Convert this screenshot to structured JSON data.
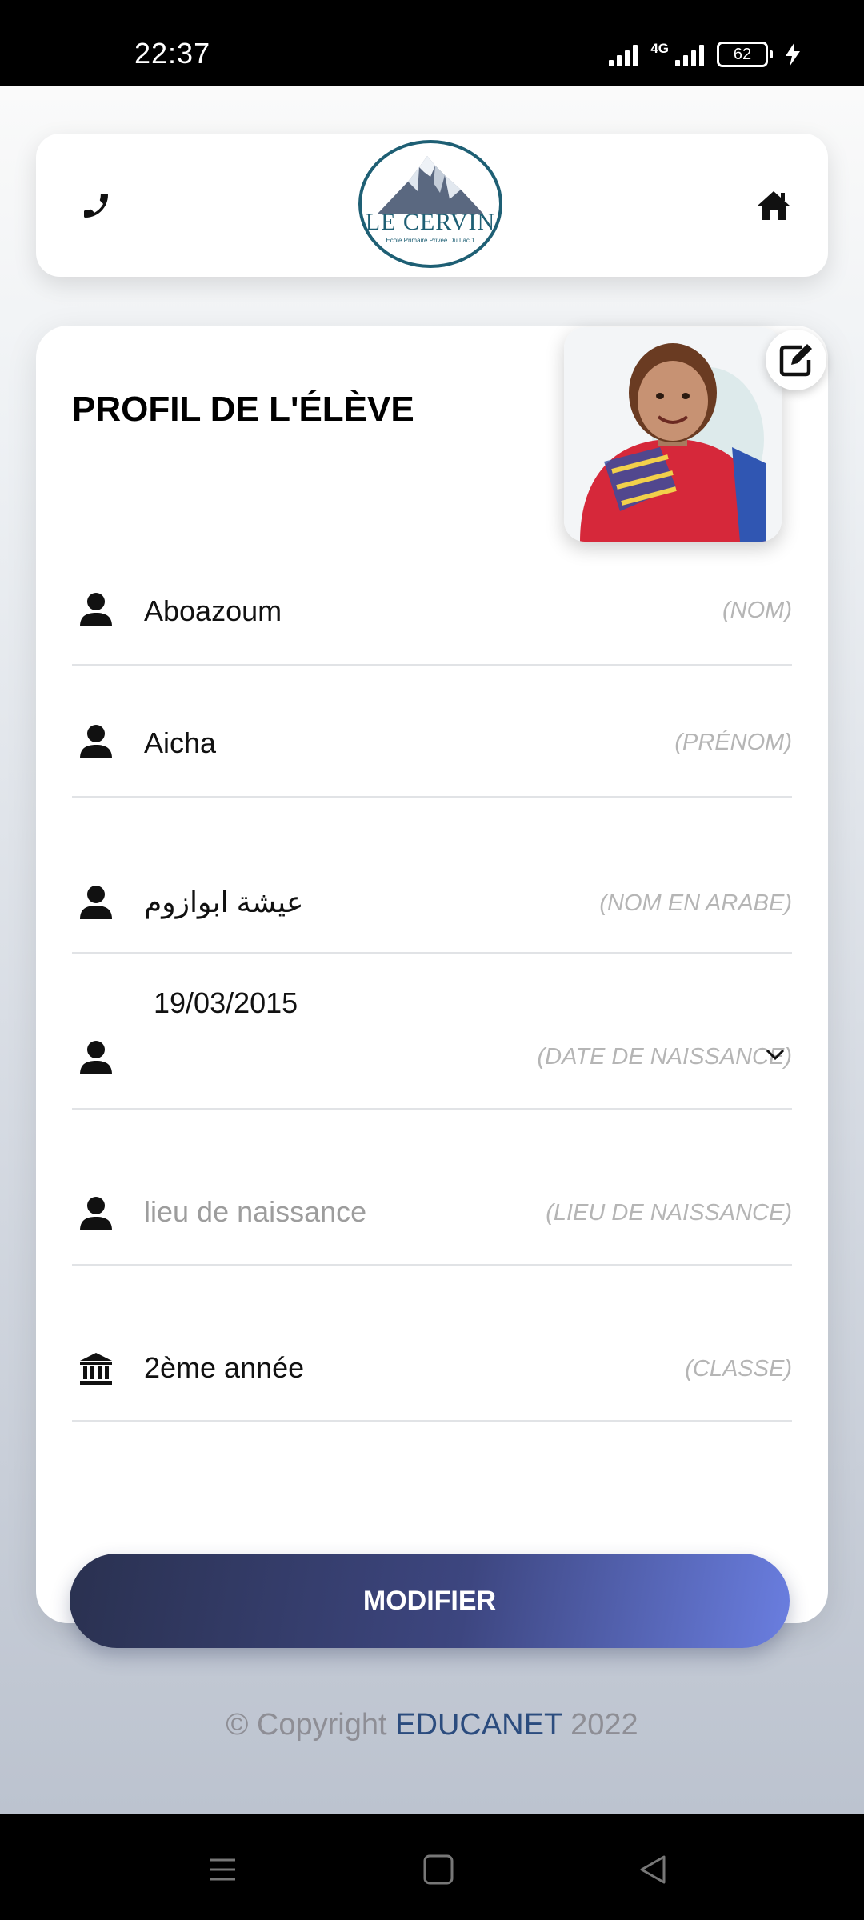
{
  "status_bar": {
    "time": "22:37",
    "network": "4G",
    "battery": "62"
  },
  "header": {
    "logo_title": "LE CERVIN",
    "logo_subtitle": "Ecole Primaire Privée Du Lac 1"
  },
  "profile": {
    "title": "PROFIL DE L'ÉLÈVE",
    "fields": [
      {
        "value": "Aboazoum",
        "label": "(NOM)",
        "icon": "person-icon"
      },
      {
        "value": "Aicha",
        "label": "(PRÉNOM)",
        "icon": "person-icon"
      },
      {
        "value": "عيشة ابوازوم",
        "label": "(NOM EN ARABE)",
        "icon": "person-icon"
      },
      {
        "value": "19/03/2015",
        "label": "(DATE DE NAISSANCE)",
        "icon": "person-icon"
      },
      {
        "placeholder": "lieu de naissance",
        "label": "(LIEU DE NAISSANCE)",
        "icon": "person-icon"
      },
      {
        "value": "2ème année",
        "label": "(CLASSE)",
        "icon": "institution-icon"
      }
    ],
    "submit_label": "MODIFIER"
  },
  "footer": {
    "prefix": "© Copyright",
    "brand": "EDUCANET",
    "year": "2022"
  },
  "colors": {
    "accent_dark": "#2a3150",
    "accent_light": "#6a7ee0",
    "brand": "#2b4c7e",
    "logo": "#1e5f74"
  }
}
